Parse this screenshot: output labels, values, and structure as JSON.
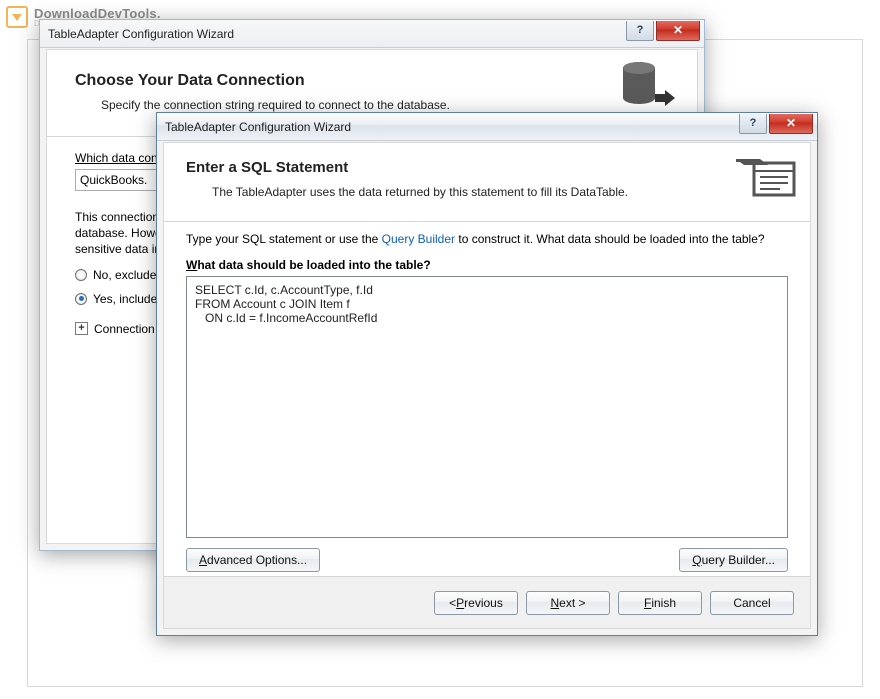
{
  "watermark": {
    "text": "DownloadDevTools.",
    "sub": "Developer's paradise"
  },
  "back": {
    "title": "TableAdapter Configuration Wizard",
    "head_title": "Choose Your Data Connection",
    "head_sub": "Specify the connection string required to connect to the database.",
    "prompt_pre": "Which data conn",
    "combo_value": "QuickBooks.",
    "para": "This connection …\ndatabase. Howev…\nsensitive data in …",
    "para_l1": "This connection",
    "para_l2": "database. Howev",
    "para_l3": "sensitive data in",
    "radio_no": "No, exclude s",
    "radio_yes": "Yes, include s",
    "expander": "Connection"
  },
  "front": {
    "title": "TableAdapter Configuration Wizard",
    "head_title": "Enter a SQL Statement",
    "head_sub": "The TableAdapter uses the data returned by this statement to fill its DataTable.",
    "link_pre": "Type your SQL statement or use the ",
    "link_text": "Query Builder",
    "link_post": " to construct it. What data should be loaded into the table?",
    "field_label_rest": "hat data should be loaded into the table?",
    "sql": "SELECT c.Id, c.AccountType, f.Id\nFROM Account c JOIN Item f\n   ON c.Id = f.IncomeAccountRefId",
    "advanced": "dvanced Options...",
    "query_builder": "uery Builder...",
    "prev": "revious",
    "next": "ext >",
    "finish": "inish",
    "cancel": "Cancel"
  }
}
